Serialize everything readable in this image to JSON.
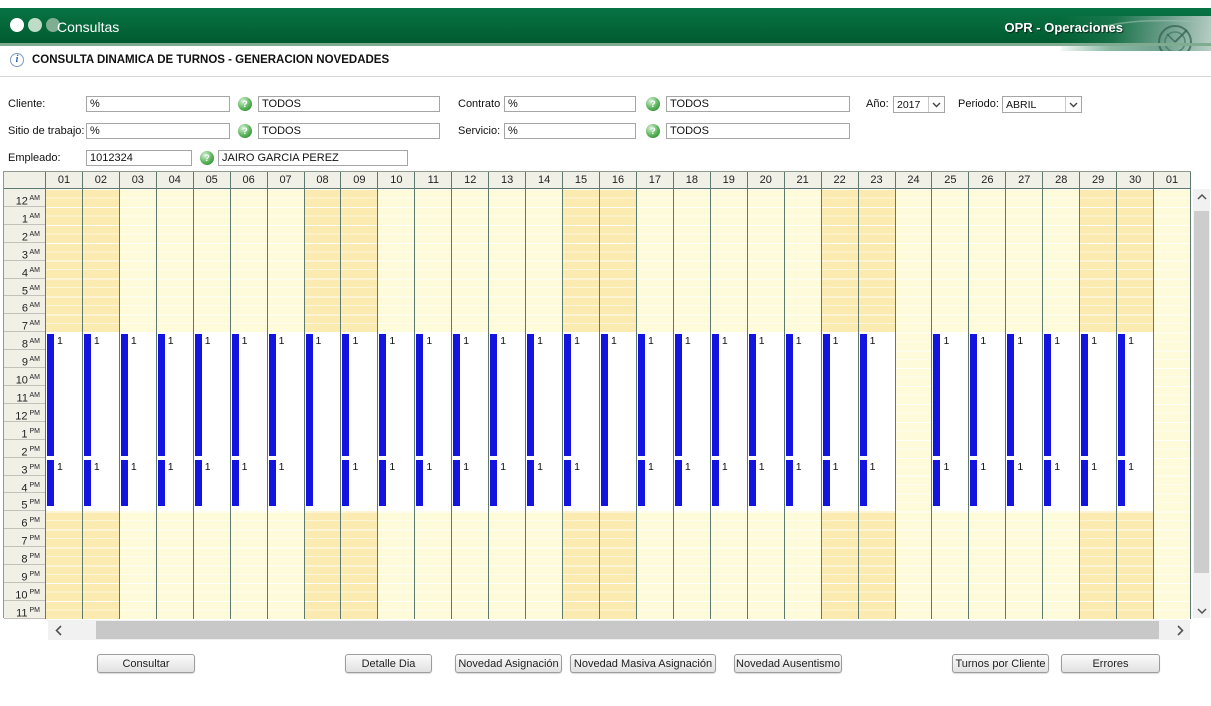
{
  "header": {
    "app_title": "Consultas",
    "module_title": "OPR - Operaciones"
  },
  "page": {
    "title": "CONSULTA DINAMICA DE TURNOS - GENERACION NOVEDADES"
  },
  "icons": {
    "info": "i",
    "lov": "?"
  },
  "filters": {
    "cliente": {
      "label": "Cliente:",
      "code": "%",
      "desc": "TODOS"
    },
    "contrato": {
      "label": "Contrato",
      "code": "%",
      "desc": "TODOS"
    },
    "anio": {
      "label": "Año:",
      "value": "2017"
    },
    "periodo": {
      "label": "Periodo:",
      "value": "ABRIL"
    },
    "sitio": {
      "label": "Sitio de trabajo:",
      "code": "%",
      "desc": "TODOS"
    },
    "servicio": {
      "label": "Servicio:",
      "code": "%",
      "desc": "TODOS"
    },
    "empleado": {
      "label": "Empleado:",
      "code": "1012324",
      "desc": "JAIRO GARCIA PEREZ"
    }
  },
  "schedule": {
    "hours": [
      {
        "n": "12",
        "m": "AM"
      },
      {
        "n": "1",
        "m": "AM"
      },
      {
        "n": "2",
        "m": "AM"
      },
      {
        "n": "3",
        "m": "AM"
      },
      {
        "n": "4",
        "m": "AM"
      },
      {
        "n": "5",
        "m": "AM"
      },
      {
        "n": "6",
        "m": "AM"
      },
      {
        "n": "7",
        "m": "AM"
      },
      {
        "n": "8",
        "m": "AM"
      },
      {
        "n": "9",
        "m": "AM"
      },
      {
        "n": "10",
        "m": "AM"
      },
      {
        "n": "11",
        "m": "AM"
      },
      {
        "n": "12",
        "m": "PM"
      },
      {
        "n": "1",
        "m": "PM"
      },
      {
        "n": "2",
        "m": "PM"
      },
      {
        "n": "3",
        "m": "PM"
      },
      {
        "n": "4",
        "m": "PM"
      },
      {
        "n": "5",
        "m": "PM"
      },
      {
        "n": "6",
        "m": "PM"
      },
      {
        "n": "7",
        "m": "PM"
      },
      {
        "n": "8",
        "m": "PM"
      },
      {
        "n": "9",
        "m": "PM"
      },
      {
        "n": "10",
        "m": "PM"
      },
      {
        "n": "11",
        "m": "PM"
      }
    ],
    "shift_window": {
      "block_start": "8 AM",
      "break_at": "3 PM",
      "block_end": "6 PM"
    },
    "days": [
      {
        "day": "01",
        "weekend": true,
        "shift": "split",
        "counts": [
          "1",
          "1"
        ]
      },
      {
        "day": "02",
        "weekend": true,
        "shift": "split",
        "counts": [
          "1",
          "1"
        ]
      },
      {
        "day": "03",
        "weekend": false,
        "shift": "split",
        "counts": [
          "1",
          "1"
        ]
      },
      {
        "day": "04",
        "weekend": false,
        "shift": "split",
        "counts": [
          "1",
          "1"
        ]
      },
      {
        "day": "05",
        "weekend": false,
        "shift": "split",
        "counts": [
          "1",
          "1"
        ]
      },
      {
        "day": "06",
        "weekend": false,
        "shift": "split",
        "counts": [
          "1",
          "1"
        ]
      },
      {
        "day": "07",
        "weekend": false,
        "shift": "split",
        "counts": [
          "1",
          "1"
        ]
      },
      {
        "day": "08",
        "weekend": true,
        "shift": "full",
        "counts": [
          "1"
        ]
      },
      {
        "day": "09",
        "weekend": true,
        "shift": "split",
        "counts": [
          "1",
          "1"
        ]
      },
      {
        "day": "10",
        "weekend": false,
        "shift": "split",
        "counts": [
          "1",
          "1"
        ]
      },
      {
        "day": "11",
        "weekend": false,
        "shift": "split",
        "counts": [
          "1",
          "1"
        ]
      },
      {
        "day": "12",
        "weekend": false,
        "shift": "split",
        "counts": [
          "1",
          "1"
        ]
      },
      {
        "day": "13",
        "weekend": false,
        "shift": "split",
        "counts": [
          "1",
          "1"
        ]
      },
      {
        "day": "14",
        "weekend": false,
        "shift": "split",
        "counts": [
          "1",
          "1"
        ]
      },
      {
        "day": "15",
        "weekend": true,
        "shift": "split",
        "counts": [
          "1",
          "1"
        ]
      },
      {
        "day": "16",
        "weekend": true,
        "shift": "full",
        "counts": [
          "1"
        ]
      },
      {
        "day": "17",
        "weekend": false,
        "shift": "split",
        "counts": [
          "1",
          "1"
        ]
      },
      {
        "day": "18",
        "weekend": false,
        "shift": "split",
        "counts": [
          "1",
          "1"
        ]
      },
      {
        "day": "19",
        "weekend": false,
        "shift": "split",
        "counts": [
          "1",
          "1"
        ]
      },
      {
        "day": "20",
        "weekend": false,
        "shift": "split",
        "counts": [
          "1",
          "1"
        ]
      },
      {
        "day": "21",
        "weekend": false,
        "shift": "split",
        "counts": [
          "1",
          "1"
        ]
      },
      {
        "day": "22",
        "weekend": true,
        "shift": "split",
        "counts": [
          "1",
          "1"
        ]
      },
      {
        "day": "23",
        "weekend": true,
        "shift": "split",
        "counts": [
          "1",
          "1"
        ]
      },
      {
        "day": "24",
        "weekend": false,
        "shift": "none",
        "counts": []
      },
      {
        "day": "25",
        "weekend": false,
        "shift": "split",
        "counts": [
          "1",
          "1"
        ]
      },
      {
        "day": "26",
        "weekend": false,
        "shift": "split",
        "counts": [
          "1",
          "1"
        ]
      },
      {
        "day": "27",
        "weekend": false,
        "shift": "split",
        "counts": [
          "1",
          "1"
        ]
      },
      {
        "day": "28",
        "weekend": false,
        "shift": "split",
        "counts": [
          "1",
          "1"
        ]
      },
      {
        "day": "29",
        "weekend": true,
        "shift": "split",
        "counts": [
          "1",
          "1"
        ]
      },
      {
        "day": "30",
        "weekend": true,
        "shift": "split",
        "counts": [
          "1",
          "1"
        ]
      },
      {
        "day": "01",
        "weekend": false,
        "shift": "none",
        "counts": []
      }
    ],
    "colors": {
      "bar": "#1414DF",
      "weekend_col": "#FBEBB1",
      "weekday_col": "#FEFBDB",
      "header_green": "#046A38"
    }
  },
  "buttons": [
    {
      "label": "Consultar"
    },
    {
      "label": "Detalle Dia"
    },
    {
      "label": "Novedad Asignación"
    },
    {
      "label": "Novedad Masiva Asignación"
    },
    {
      "label": "Novedad Ausentismo"
    },
    {
      "label": "Turnos por Cliente"
    },
    {
      "label": "Errores"
    }
  ]
}
